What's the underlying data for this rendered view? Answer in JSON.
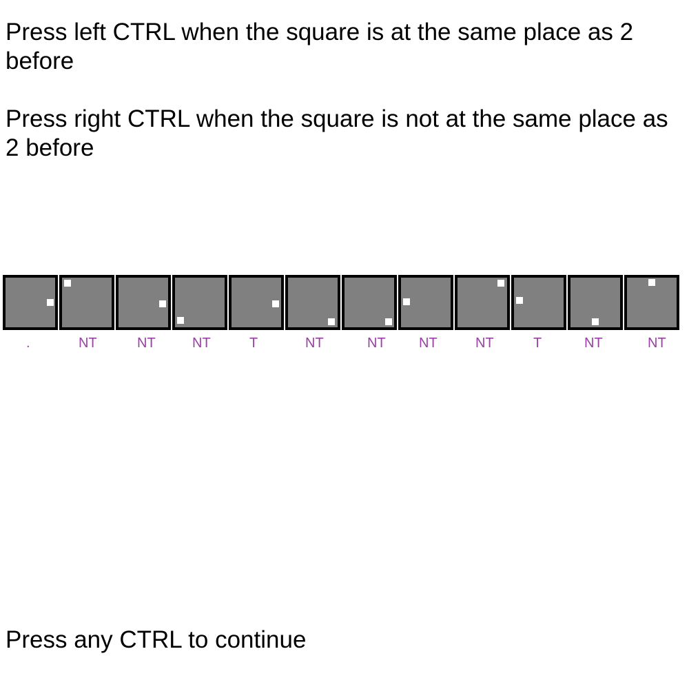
{
  "instructions": {
    "left_ctrl": "Press left CTRL when the square is at the same place as 2 before",
    "right_ctrl": "Press right CTRL when the square is not at the same place as 2 before",
    "continue": "Press any CTRL to continue"
  },
  "colors": {
    "background": "#ffffff",
    "text": "#000000",
    "tile_fill": "#808080",
    "tile_border": "#000000",
    "square": "#ffffff",
    "label": "#9b3fa6"
  },
  "sequence": [
    {
      "label": "."
    },
    {
      "label": "NT"
    },
    {
      "label": "NT"
    },
    {
      "label": "NT"
    },
    {
      "label": "T"
    },
    {
      "label": "NT"
    },
    {
      "label": "NT"
    },
    {
      "label": "NT"
    },
    {
      "label": "NT"
    },
    {
      "label": "T"
    },
    {
      "label": "NT"
    },
    {
      "label": "NT"
    }
  ]
}
